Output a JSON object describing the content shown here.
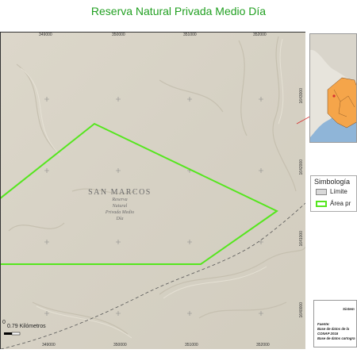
{
  "title": "Reserva Natural Privada Medio Día",
  "map": {
    "place_name": "SAN MARCOS",
    "reserve_label": [
      "Reserva",
      "Natural",
      "Privada Medio",
      "Día"
    ],
    "top_ticks": [
      "349000",
      "350000",
      "351000",
      "352000"
    ],
    "bottom_ticks": [
      "349000",
      "350000",
      "351000",
      "352000"
    ],
    "right_ticks": [
      "1643000",
      "1642000",
      "1641000",
      "1640000"
    ],
    "scale_text": "0.79 Kilómetros",
    "scale_zero": "0",
    "colors": {
      "protected_area": "#55e61e",
      "terrain": "#d8d3c6",
      "water": "#8fb5d8",
      "region": "#f5a54a"
    }
  },
  "legend": {
    "title": "Simbología",
    "items": [
      {
        "label": "Límite",
        "swatch": "#d9d9d9",
        "border": "#888888"
      },
      {
        "label": "Área pr",
        "swatch": "#ffffff",
        "border": "#55e61e"
      }
    ]
  },
  "sources": {
    "heading": "Sistem",
    "lines": [
      "Fuente:",
      "Base de datos de la",
      "CONAP 2016",
      "Base de datos cartogra"
    ]
  }
}
